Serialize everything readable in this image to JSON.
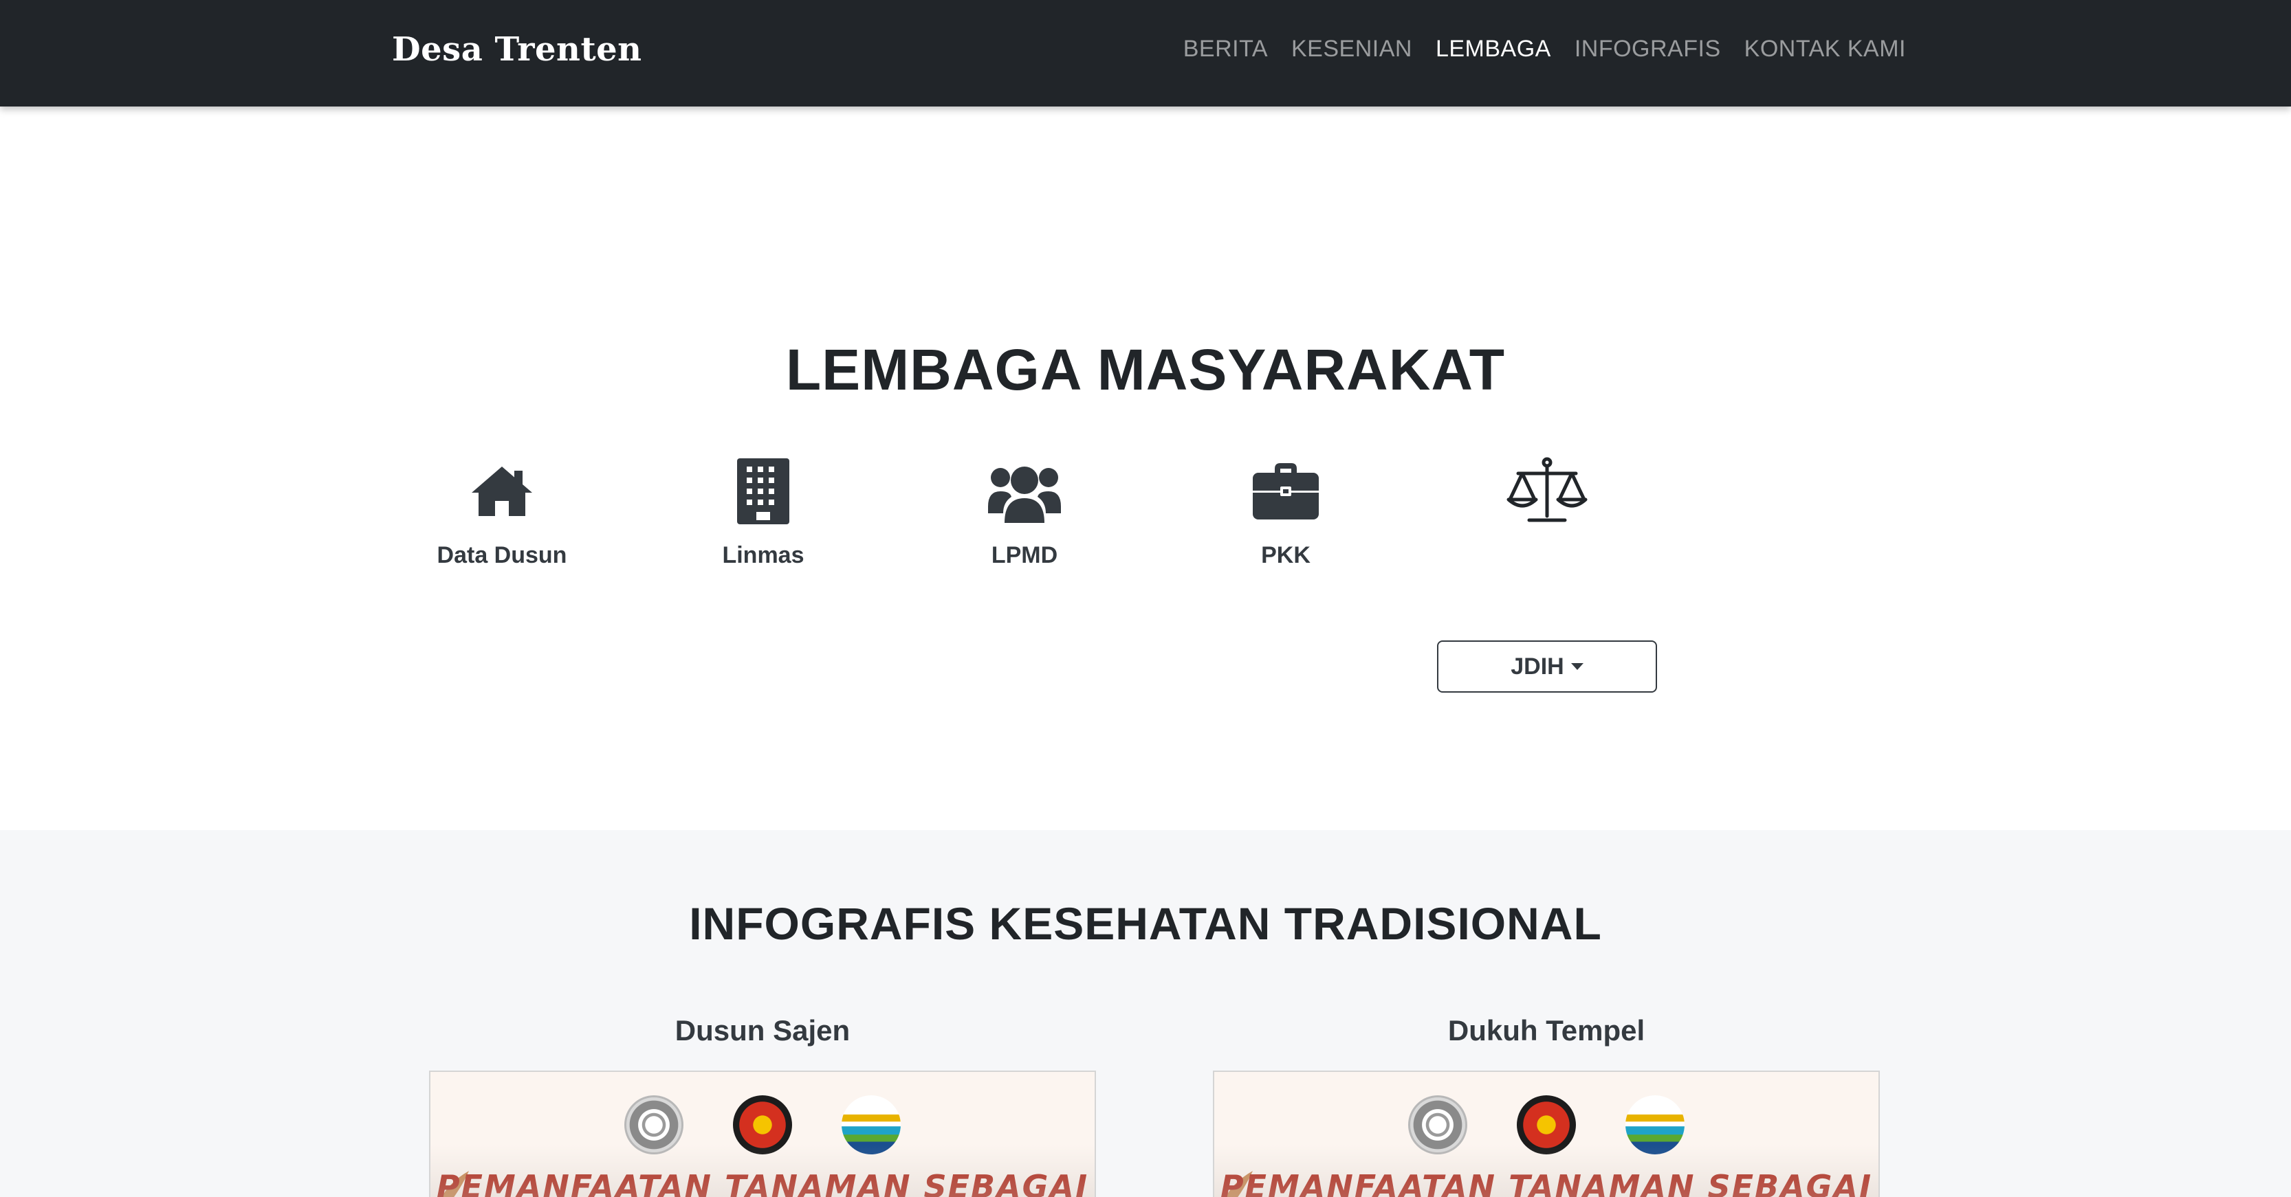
{
  "navbar": {
    "brand": "Desa Trenten",
    "links": [
      {
        "label": "BERITA"
      },
      {
        "label": "KESENIAN"
      },
      {
        "label": "LEMBAGA"
      },
      {
        "label": "INFOGRAFIS"
      },
      {
        "label": "KONTAK KAMI"
      }
    ],
    "active": "LEMBAGA"
  },
  "lembaga": {
    "title": "LEMBAGA MASYARAKAT",
    "items": [
      {
        "label": "Data Dusun",
        "icon": "house-icon"
      },
      {
        "label": "Linmas",
        "icon": "building-icon"
      },
      {
        "label": "LPMD",
        "icon": "users-icon"
      },
      {
        "label": "PKK",
        "icon": "briefcase-icon"
      }
    ],
    "dropdown": {
      "label": "JDIH",
      "icon": "scale-icon"
    }
  },
  "infografis": {
    "title": "INFOGRAFIS KESEHATAN TRADISIONAL",
    "columns": [
      {
        "title": "Dusun Sajen",
        "card_heading": "PEMANFAATAN TANAMAN SEBAGAI"
      },
      {
        "title": "Dukuh Tempel",
        "card_heading": "PEMANFAATAN TANAMAN SEBAGAI"
      }
    ]
  },
  "colors": {
    "navbar": "#212529",
    "text_dark": "#343a40",
    "section_alt": "#f6f7f9",
    "poster_heading": "#b23224"
  }
}
